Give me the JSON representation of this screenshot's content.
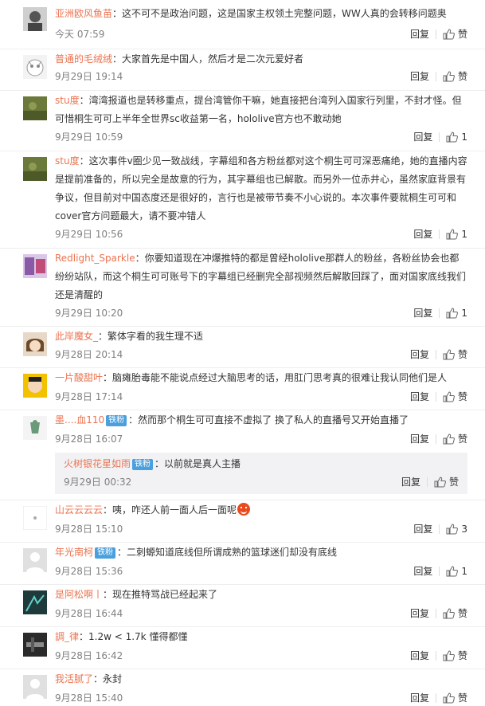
{
  "actions": {
    "reply": "回复",
    "like": "赞"
  },
  "comments": [
    {
      "user": "亚洲欧风鱼苗",
      "text": "：这不可不是政治问题，这是国家主权领土完整问题，WW人真的会转移问题奥",
      "time": "今天 07:59",
      "likes": "赞"
    },
    {
      "user": "普通的毛绒绒",
      "text": "：大家首先是中国人，然后才是二次元爱好者",
      "time": "9月29日 19:14",
      "likes": "赞"
    },
    {
      "user": "stu度",
      "text": "：湾湾报道也是转移重点，提台湾管你干嘛，她直接把台湾列入国家行列里，不封才怪。但可惜桐生可可上半年全世界sc收益第一名，hololive官方也不敢动她",
      "time": "9月29日 10:59",
      "likes": "1"
    },
    {
      "user": "stu度",
      "text": "：这次事件v圈少见一致战线，字幕组和各方粉丝都对这个桐生可可深恶痛绝，她的直播内容是提前准备的，所以完全是故意的行为，其字幕组也已解散。而另外一位赤井心，虽然家庭背景有争议，但目前对中国态度还是很好的，言行也是被带节奏不小心说的。本次事件要就桐生可可和cover官方问题最大，请不要冲错人",
      "time": "9月29日 10:56",
      "likes": "1"
    },
    {
      "user": "Redlight_Sparkle",
      "text": "：你要知道现在冲爆推特的都是曾经hololive那群人的粉丝，各粉丝协会也都纷纷站队，而这个桐生可可账号下的字幕组已经删完全部视频然后解散回踩了，面对国家底线我们还是清醒的",
      "time": "9月29日 10:20",
      "likes": "1"
    },
    {
      "user": "此岸魔女_",
      "text": "：繁体字看的我生理不适",
      "time": "9月28日 20:14",
      "likes": "赞"
    },
    {
      "user": "一片酸甜叶",
      "text": "：脑瘫胎毒能不能说点经过大脑思考的话，用肛门思考真的很难让我认同他们是人",
      "time": "9月28日 17:14",
      "likes": "赞"
    },
    {
      "user": "墨....血110",
      "badge": "铁粉",
      "text": "：然而那个桐生可可直接不虚拟了 换了私人的直播号又开始直播了",
      "time": "9月28日 16:07",
      "likes": "赞",
      "reply": {
        "user": "火树银花星如雨",
        "badge": "铁粉",
        "text": "：以前就是真人主播",
        "time": "9月29日 00:32",
        "likes": "赞"
      }
    },
    {
      "user": "山云云云云",
      "text": "：咦，咋还人前一面人后一面呢",
      "emoji": true,
      "time": "9月28日 15:10",
      "likes": "3"
    },
    {
      "user": "年光南柯",
      "badge": "铁粉",
      "text": "：二刺螈知道底线但所谓成熟的篮球迷们却没有底线",
      "time": "9月28日 15:36",
      "likes": "1"
    },
    {
      "user": "是阿松啊丨",
      "text": "：现在推特骂战已经起来了",
      "time": "9月28日 16:44",
      "likes": "赞"
    },
    {
      "user": "調_律",
      "text": "：1.2w < 1.7k 懂得都懂",
      "time": "9月28日 16:42",
      "likes": "赞"
    },
    {
      "user": "我活腻了",
      "text": "：永封",
      "time": "9月28日 15:40",
      "likes": "赞"
    }
  ]
}
